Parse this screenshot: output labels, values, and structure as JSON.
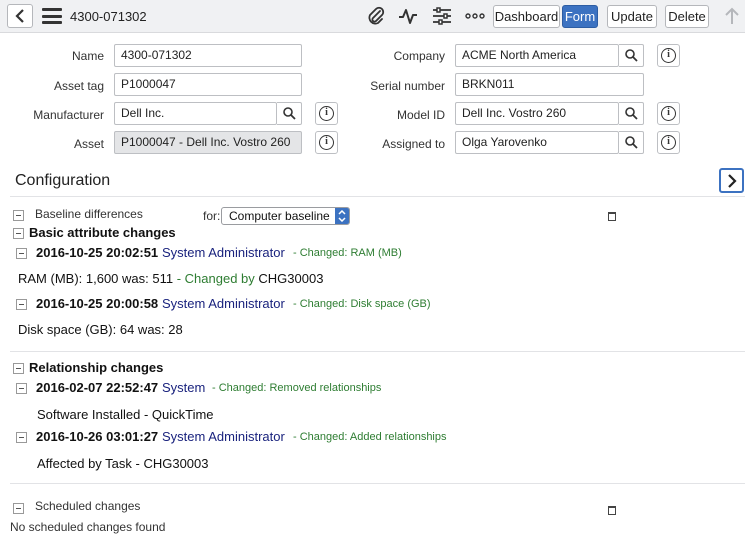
{
  "header": {
    "title": "4300-071302",
    "buttons": {
      "dashboard": "Dashboard",
      "form": "Form",
      "update": "Update",
      "delete": "Delete"
    },
    "icons": [
      "back-icon",
      "menu-icon",
      "paperclip-icon",
      "activity-icon",
      "settings-icon",
      "more-icon",
      "up-arrow-icon"
    ],
    "accent_color": "#3c72c1"
  },
  "form": {
    "name_label": "Name",
    "name_value": "4300-071302",
    "asset_tag_label": "Asset tag",
    "asset_tag_value": "P1000047",
    "manufacturer_label": "Manufacturer",
    "manufacturer_value": "Dell Inc.",
    "asset_label": "Asset",
    "asset_value": "P1000047 - Dell Inc. Vostro 260",
    "company_label": "Company",
    "company_value": "ACME North America",
    "serial_label": "Serial number",
    "serial_value": "BRKN011",
    "model_label": "Model ID",
    "model_value": "Dell Inc. Vostro 260",
    "assigned_label": "Assigned to",
    "assigned_value": "Olga Yarovenko"
  },
  "configuration": {
    "title": "Configuration",
    "baseline_label": "Baseline differences",
    "for_label": "for:",
    "baseline_select": "Computer baseline",
    "basic_title": "Basic attribute changes",
    "basic": [
      {
        "date": "2016-10-25 20:02:51",
        "user": "System Administrator",
        "changed": "- Changed:  RAM (MB)",
        "d1": "RAM (MB):  1,600   was:  511 ",
        "d2": "- Changed by ",
        "d3": "CHG30003"
      },
      {
        "date": "2016-10-25 20:00:58",
        "user": "System Administrator",
        "changed": "- Changed:  Disk space (GB)",
        "d1": "Disk space (GB):  64   was:  28"
      }
    ],
    "relationship_title": "Relationship changes",
    "relationships": [
      {
        "date": "2016-02-07 22:52:47",
        "user": "System",
        "changed": "- Changed:  Removed relationships",
        "detail": "Software Installed - QuickTime"
      },
      {
        "date": "2016-10-26 03:01:27",
        "user": "System Administrator",
        "changed": "- Changed:  Added relationships",
        "detail": "Affected by Task - CHG30003"
      }
    ],
    "scheduled_label": "Scheduled changes",
    "scheduled_empty": "No scheduled changes found"
  }
}
